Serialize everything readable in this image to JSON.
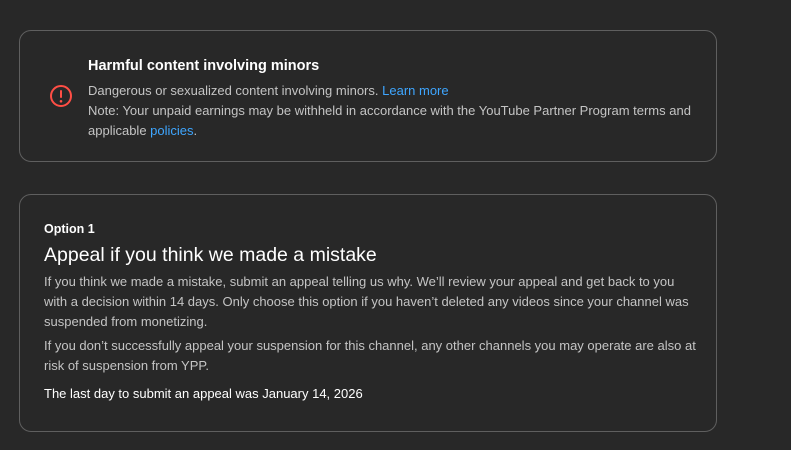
{
  "violation": {
    "icon": "alert-circle-icon",
    "icon_color": "#ff4e45",
    "title": "Harmful content involving minors",
    "description": "Dangerous or sexualized content involving minors.",
    "learn_more": "Learn more",
    "note_prefix": "Note: Your unpaid earnings may be withheld in accordance with the YouTube Partner Program terms and applicable",
    "policies_link": "policies",
    "note_suffix": "."
  },
  "option": {
    "label": "Option 1",
    "title": "Appeal if you think we made a mistake",
    "paragraph_1": "If you think we made a mistake, submit an appeal telling us why. We’ll review your appeal and get back to you with a decision within 14 days. Only choose this option if you haven’t deleted any videos since your channel was suspended from monetizing.",
    "paragraph_2": "If you don’t successfully appeal your suspension for this channel, any other channels you may operate are also at risk of suspension from YPP.",
    "deadline": "The last day to submit an appeal was January 14, 2026"
  },
  "colors": {
    "background": "#282828",
    "border": "#5f5f5f",
    "link": "#3ea6ff"
  }
}
